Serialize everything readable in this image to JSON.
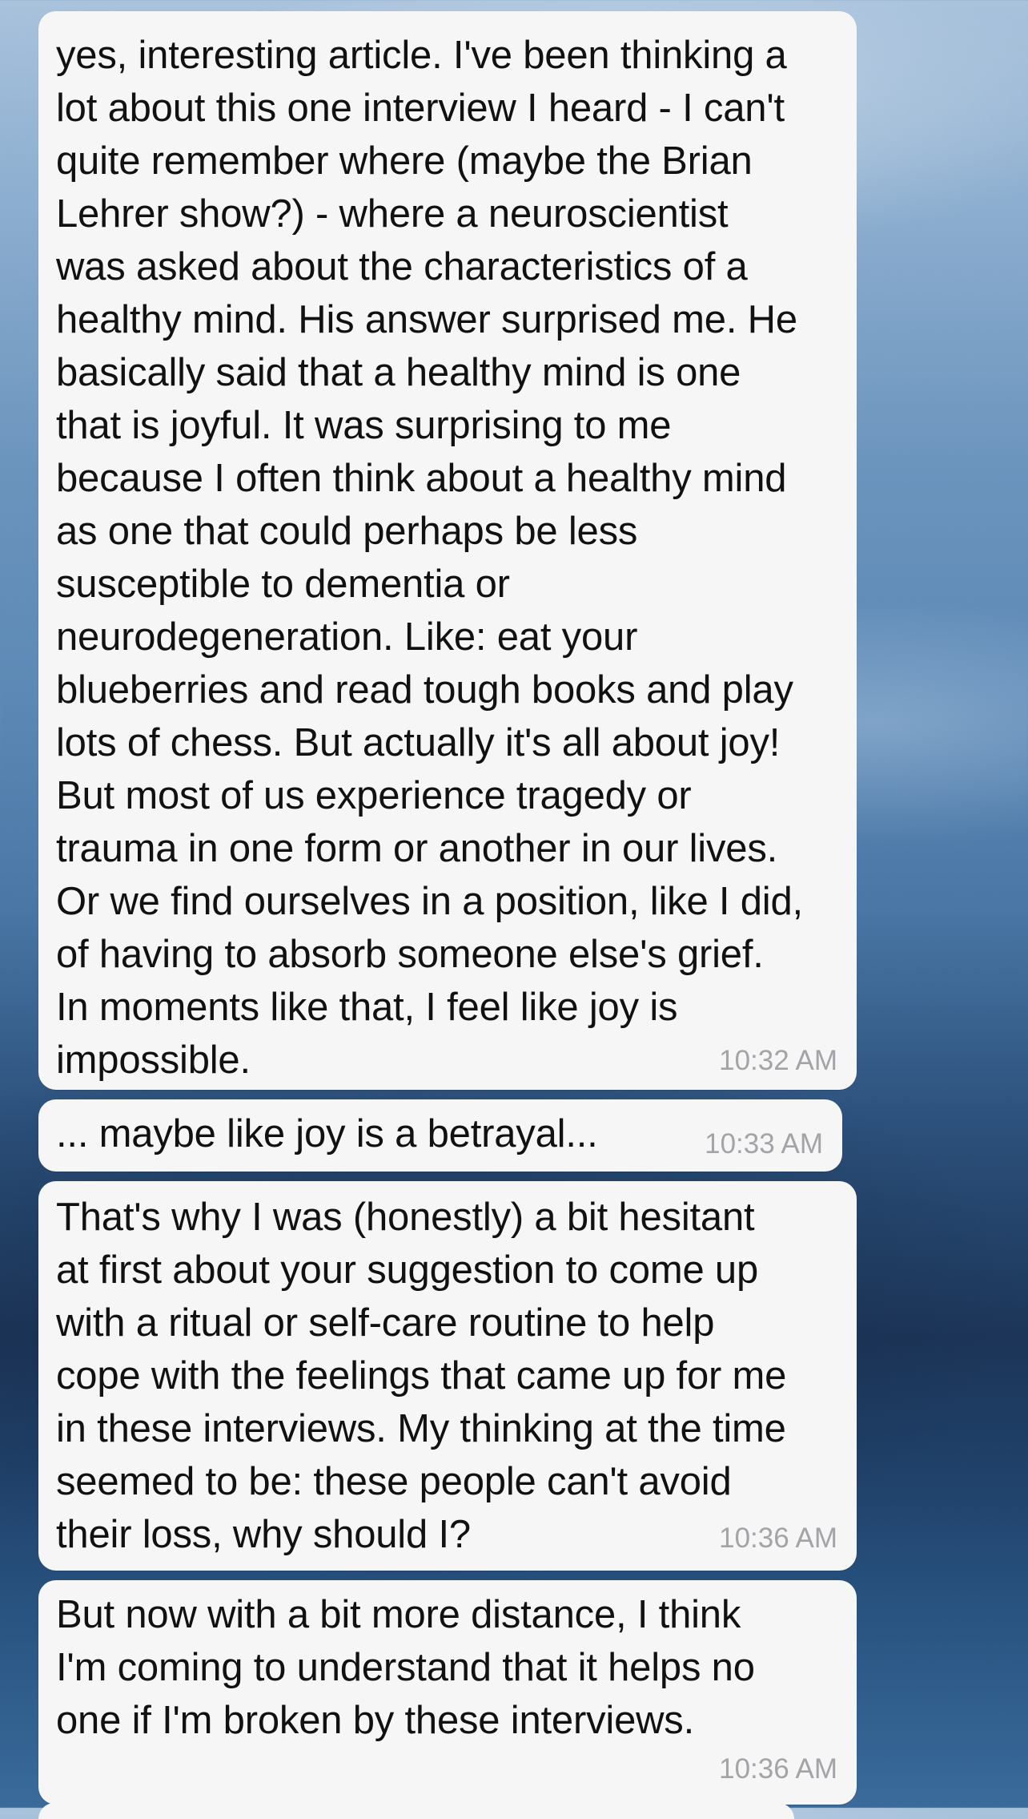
{
  "messages": [
    {
      "text": "yes, interesting article. I've been thinking a\nlot about this one interview I heard - I can't\nquite remember where (maybe the Brian\nLehrer show?) - where a neuroscientist\nwas asked about the characteristics of a\nhealthy mind. His answer surprised me. He\nbasically said that a healthy mind is one\nthat is joyful. It was surprising to me\nbecause I often think about a healthy mind\nas one that could perhaps be less\nsusceptible to dementia or\nneurodegeneration. Like: eat your\nblueberries and read tough books and play\nlots of chess. But actually it's all about joy!\nBut most of us experience tragedy or\ntrauma in one form or another in our lives.\nOr we find ourselves in a position, like I did,\nof having to absorb someone else's grief.\nIn moments like that, I feel like joy is\nimpossible.",
      "time": "10:32 AM"
    },
    {
      "text": "... maybe like joy is a betrayal...",
      "time": "10:33 AM"
    },
    {
      "text": "That's why I was (honestly) a bit hesitant\nat first about your suggestion to come up\nwith a ritual or self-care routine to help\ncope with the feelings that came up for me\nin these interviews. My thinking at the time\nseemed to be: these people can't avoid\ntheir loss, why should I?",
      "time": "10:36 AM"
    },
    {
      "text": "But now with a bit more distance, I think\nI'm coming to understand that it helps no\none if I'm broken by these interviews.",
      "time": "10:36 AM"
    }
  ]
}
